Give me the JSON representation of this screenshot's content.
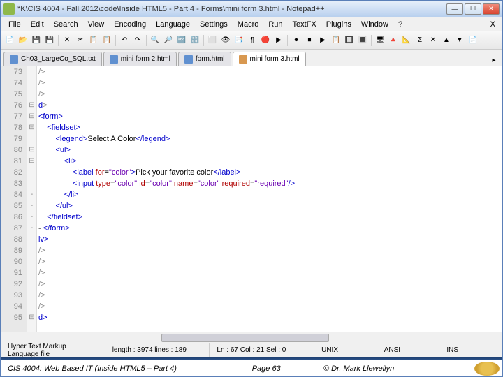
{
  "title": "*K\\CIS 4004 - Fall 2012\\code\\Inside HTML5 - Part 4 - Forms\\mini form 3.html - Notepad++",
  "menu": [
    "File",
    "Edit",
    "Search",
    "View",
    "Encoding",
    "Language",
    "Settings",
    "Macro",
    "Run",
    "TextFX",
    "Plugins",
    "Window",
    "?"
  ],
  "tabs": [
    {
      "label": "Ch03_LargeCo_SQL.txt",
      "active": false,
      "blue": true
    },
    {
      "label": "mini form 2.html",
      "active": false,
      "blue": true
    },
    {
      "label": "form.html",
      "active": false,
      "blue": true
    },
    {
      "label": "mini form 3.html",
      "active": true,
      "blue": false
    }
  ],
  "lines": [
    {
      "n": "73",
      "f": "",
      "h": "<span class='gry'>/&gt;</span>"
    },
    {
      "n": "74",
      "f": "",
      "h": "<span class='gry'>/&gt;</span>"
    },
    {
      "n": "75",
      "f": "",
      "h": "<span class='gry'>/&gt;</span>"
    },
    {
      "n": "76",
      "f": "⊟",
      "h": "<span class='tag'>d</span><span class='gry'>&gt;</span>"
    },
    {
      "n": "77",
      "f": "⊟",
      "h": "<span class='tag'>&lt;form&gt;</span>"
    },
    {
      "n": "78",
      "f": "⊟",
      "h": "    <span class='tag'>&lt;fieldset&gt;</span>"
    },
    {
      "n": "79",
      "f": "",
      "h": "        <span class='tag'>&lt;legend&gt;</span><span class='txt'>Select A Color</span><span class='tag'>&lt;/legend&gt;</span>"
    },
    {
      "n": "80",
      "f": "⊟",
      "h": "        <span class='tag'>&lt;ul&gt;</span>"
    },
    {
      "n": "81",
      "f": "⊟",
      "h": "            <span class='tag'>&lt;li&gt;</span>"
    },
    {
      "n": "82",
      "f": "",
      "h": "                <span class='tag'>&lt;label</span> <span class='attr'>for</span>=<span class='val'>\"color\"</span><span class='tag'>&gt;</span><span class='txt'>Pick your favorite color</span><span class='tag'>&lt;/label&gt;</span>"
    },
    {
      "n": "83",
      "f": "",
      "h": "                <span class='tag'>&lt;input</span> <span class='attr'>type</span>=<span class='val'>\"color\"</span> <span class='attr'>id</span>=<span class='val'>\"color\"</span> <span class='attr'>name</span>=<span class='val'>\"color\"</span> <span class='attr'>required</span>=<span class='val'>\"required\"</span><span class='tag'>/&gt;</span>"
    },
    {
      "n": "84",
      "f": "-",
      "h": "            <span class='tag'>&lt;/li&gt;</span>"
    },
    {
      "n": "85",
      "f": "-",
      "h": "        <span class='tag'>&lt;/ul&gt;</span>"
    },
    {
      "n": "86",
      "f": "-",
      "h": "    <span class='tag'>&lt;/fieldset&gt;</span>"
    },
    {
      "n": "87",
      "f": "-",
      "h": "- <span class='tag'>&lt;/form&gt;</span>"
    },
    {
      "n": "88",
      "f": "",
      "h": "<span class='tag'>iv&gt;</span>"
    },
    {
      "n": "89",
      "f": "",
      "h": "<span class='gry'>/&gt;</span>"
    },
    {
      "n": "90",
      "f": "",
      "h": "<span class='gry'>/&gt;</span>"
    },
    {
      "n": "91",
      "f": "",
      "h": "<span class='gry'>/&gt;</span>"
    },
    {
      "n": "92",
      "f": "",
      "h": "<span class='gry'>/&gt;</span>"
    },
    {
      "n": "93",
      "f": "",
      "h": "<span class='gry'>/&gt;</span>"
    },
    {
      "n": "94",
      "f": "",
      "h": "<span class='gry'>/&gt;</span>"
    },
    {
      "n": "95",
      "f": "⊟",
      "h": "<span class='tag'>d&gt;</span>"
    }
  ],
  "status": {
    "lang": "Hyper Text Markup Language file",
    "length": "length : 3974   lines : 189",
    "pos": "Ln : 67   Col : 21   Sel : 0",
    "eol": "UNIX",
    "enc": "ANSI",
    "ins": "INS"
  },
  "footer": {
    "left": "CIS 4004: Web Based IT (Inside HTML5 – Part 4)",
    "mid": "Page 63",
    "right": "© Dr. Mark Llewellyn"
  }
}
